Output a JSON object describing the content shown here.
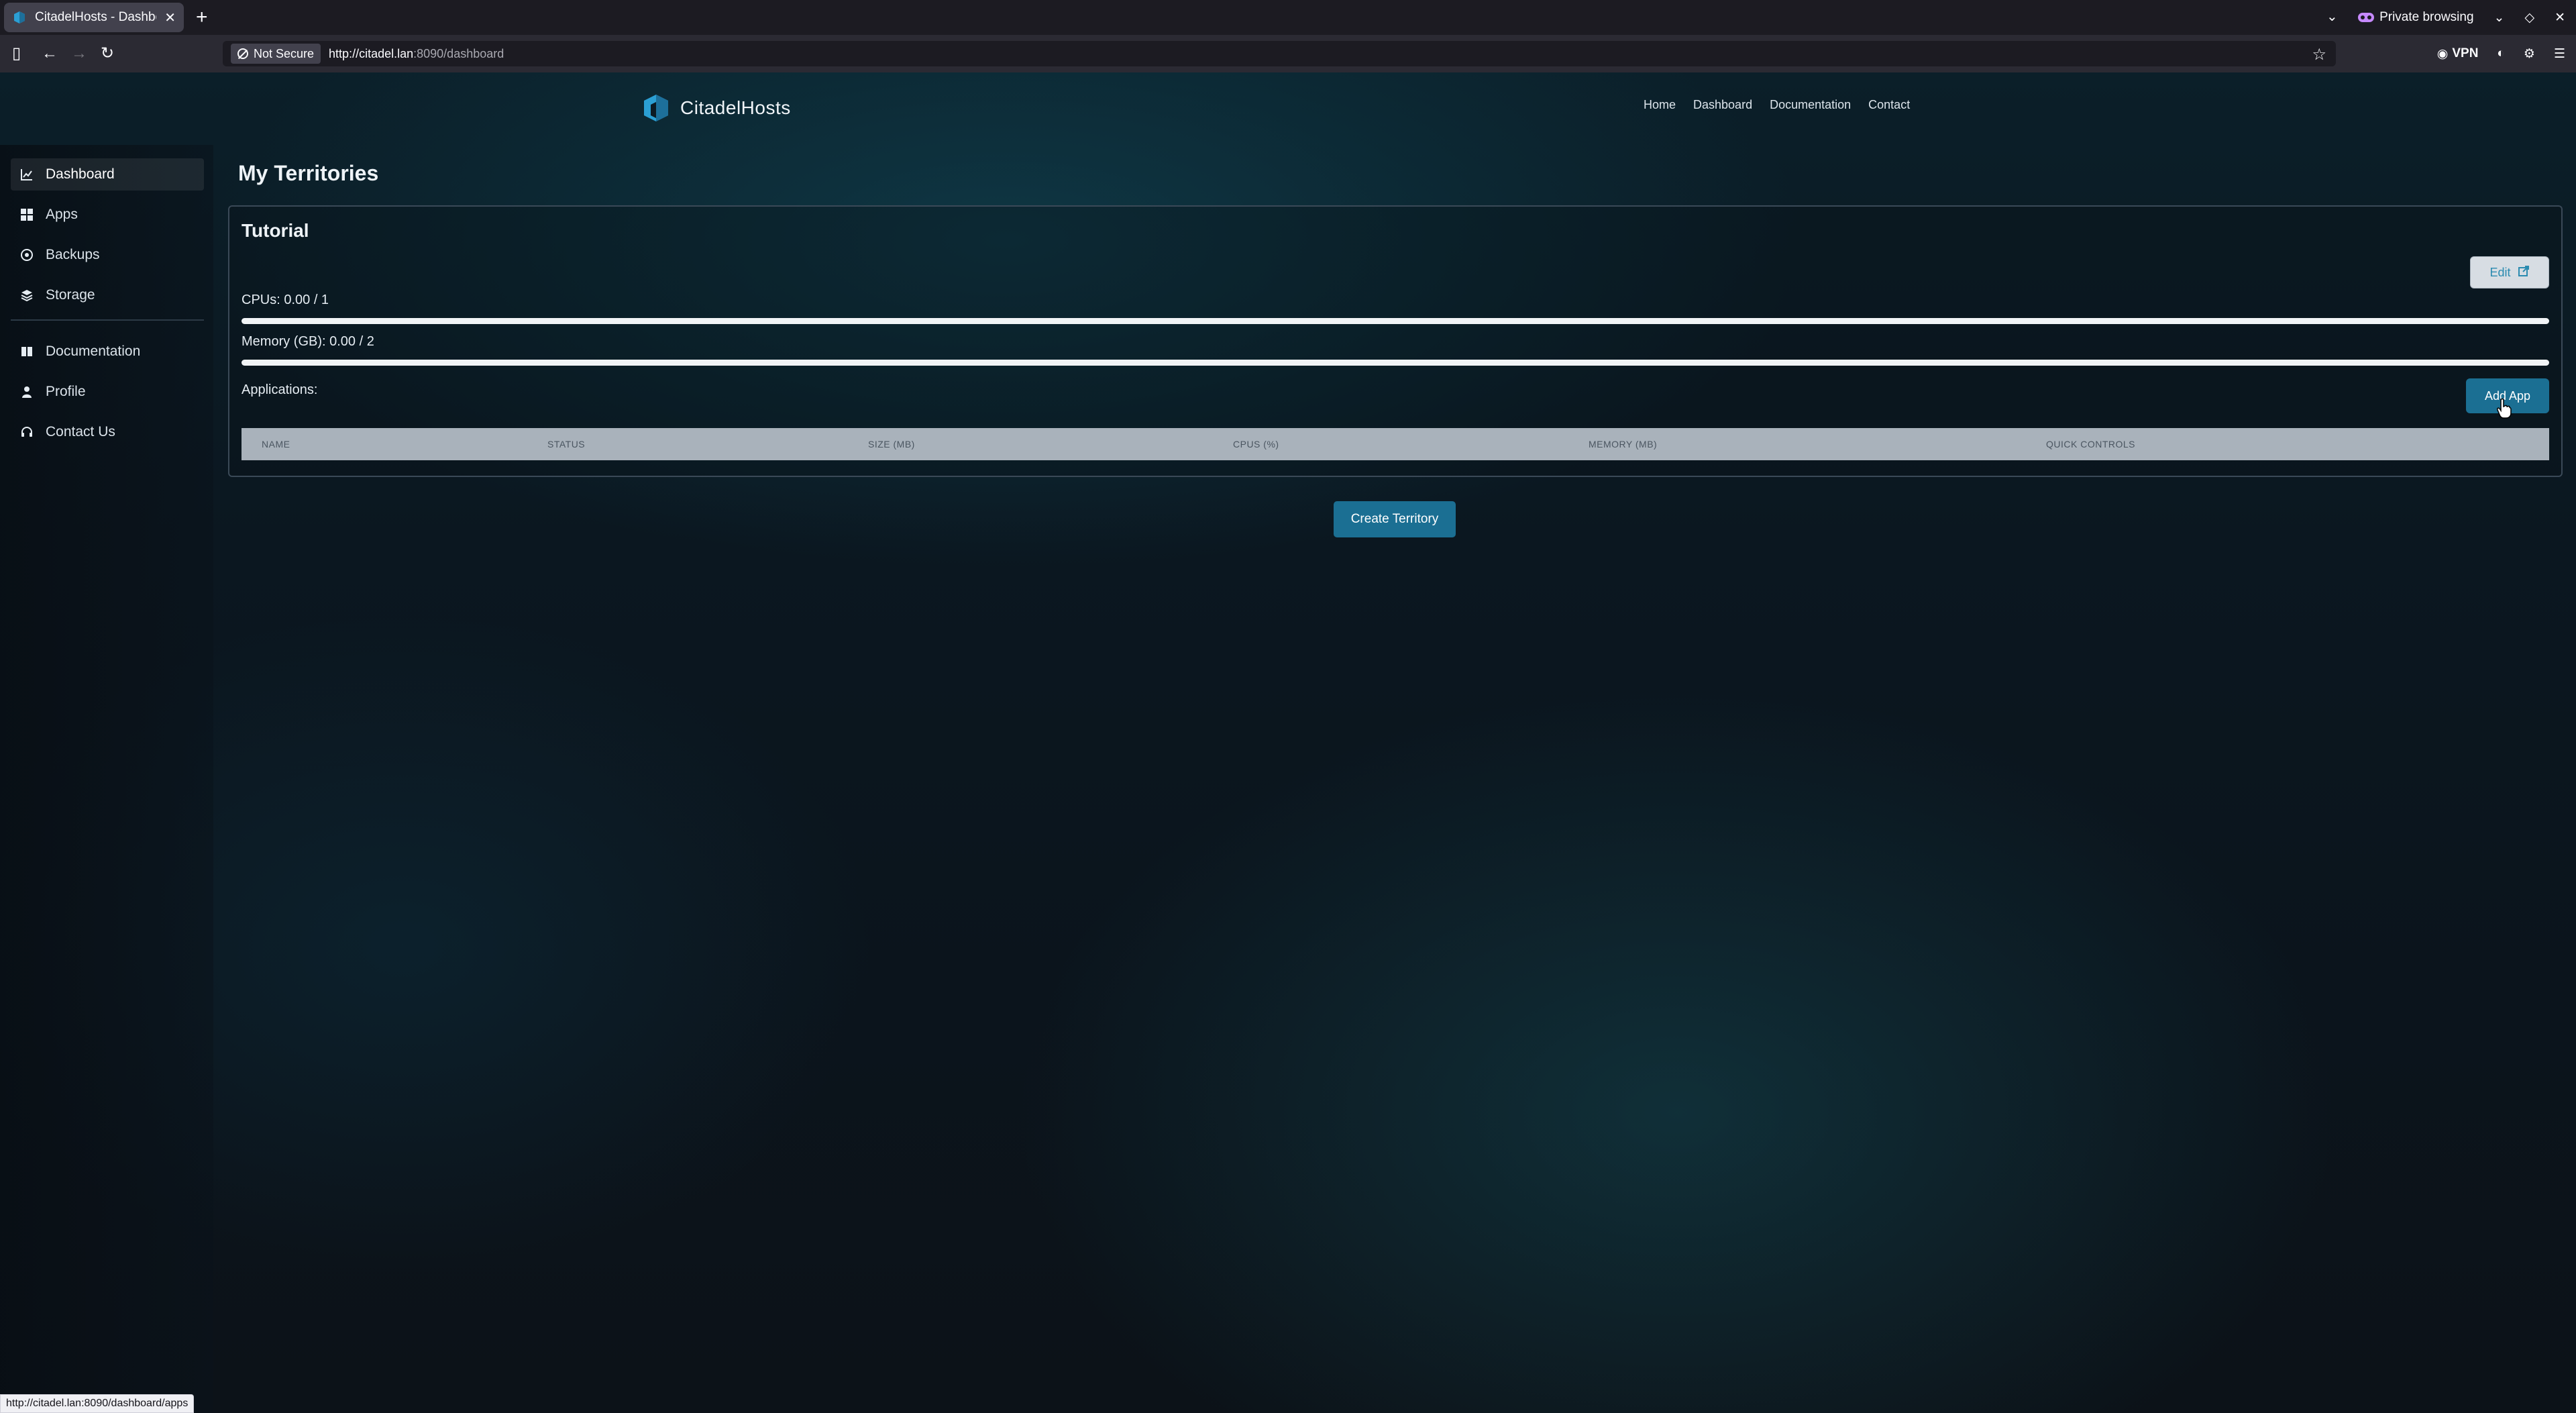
{
  "browser": {
    "tab_title": "CitadelHosts - Dashboard",
    "tab_close": "✕",
    "new_tab": "+",
    "private_label": "Private browsing",
    "not_secure": "Not Secure",
    "url_host": "http://citadel.lan",
    "url_path": ":8090/dashboard",
    "vpn_label": "VPN",
    "status_url": "http://citadel.lan:8090/dashboard/apps"
  },
  "site": {
    "brand": "CitadelHosts",
    "nav": [
      "Home",
      "Dashboard",
      "Documentation",
      "Contact"
    ]
  },
  "sidebar": {
    "items": [
      {
        "label": "Dashboard",
        "icon": "chart-line-icon",
        "active": true
      },
      {
        "label": "Apps",
        "icon": "grid-icon",
        "active": false
      },
      {
        "label": "Backups",
        "icon": "backup-icon",
        "active": false
      },
      {
        "label": "Storage",
        "icon": "layers-icon",
        "active": false
      }
    ],
    "secondary": [
      {
        "label": "Documentation",
        "icon": "book-icon"
      },
      {
        "label": "Profile",
        "icon": "user-icon"
      },
      {
        "label": "Contact Us",
        "icon": "headset-icon"
      }
    ]
  },
  "main": {
    "title": "My Territories",
    "territory": {
      "name": "Tutorial",
      "edit_label": "Edit",
      "cpu_label": "CPUs: 0.00 / 1",
      "cpu_fraction": 0,
      "memory_label": "Memory (GB): 0.00 / 2",
      "memory_fraction": 0,
      "applications_label": "Applications:",
      "add_app_label": "Add App",
      "table_headers": [
        "NAME",
        "STATUS",
        "SIZE (MB)",
        "CPUS (%)",
        "MEMORY (MB)",
        "QUICK CONTROLS"
      ]
    },
    "create_label": "Create Territory"
  },
  "colors": {
    "accent": "#1b6f93",
    "logo": "#2b9fd4"
  }
}
